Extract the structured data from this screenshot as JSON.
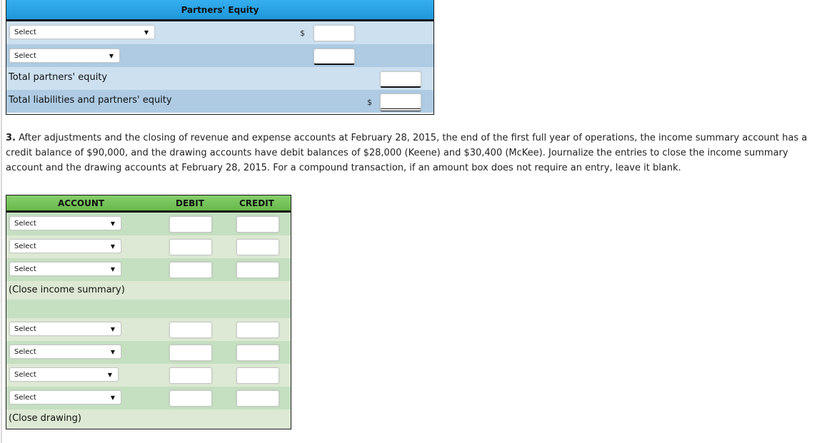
{
  "partners_equity": {
    "title": "Partners' Equity",
    "rows": [
      {
        "type": "select",
        "value": "Select",
        "dollar": "$"
      },
      {
        "type": "select",
        "value": "Select",
        "dollar": ""
      },
      {
        "type": "label",
        "label": "Total partners' equity",
        "dollar": ""
      },
      {
        "type": "label",
        "label": "Total liabilities and partners' equity",
        "dollar": "$"
      }
    ]
  },
  "question": {
    "number": "3.",
    "text": "After adjustments and the closing of revenue and expense accounts at February 28, 2015, the end of the first full year of operations, the income summary account has a credit balance of $90,000, and the drawing accounts have debit balances of $28,000 (Keene) and $30,400 (McKee). Journalize the entries to close the income summary account and the drawing accounts at February 28, 2015. For a compound transaction, if an amount box does not require an entry, leave it blank."
  },
  "journal": {
    "headers": {
      "account": "ACCOUNT",
      "debit": "DEBIT",
      "credit": "CREDIT"
    },
    "entry1": {
      "selects": [
        "Select",
        "Select",
        "Select"
      ],
      "note": "(Close income summary)"
    },
    "entry2": {
      "selects": [
        "Select",
        "Select",
        "Select",
        "Select"
      ],
      "note": "(Close drawing)"
    }
  },
  "icons": {
    "dropdown_arrow": "▼"
  },
  "colors": {
    "blue_header": "#2aa3e6",
    "blue_light_row": "#cde0f0",
    "blue_dark_row": "#aecbe3",
    "green_header": "#76c45c",
    "green_dark_row": "#c5dfc1",
    "green_light_row": "#dde9d4"
  }
}
